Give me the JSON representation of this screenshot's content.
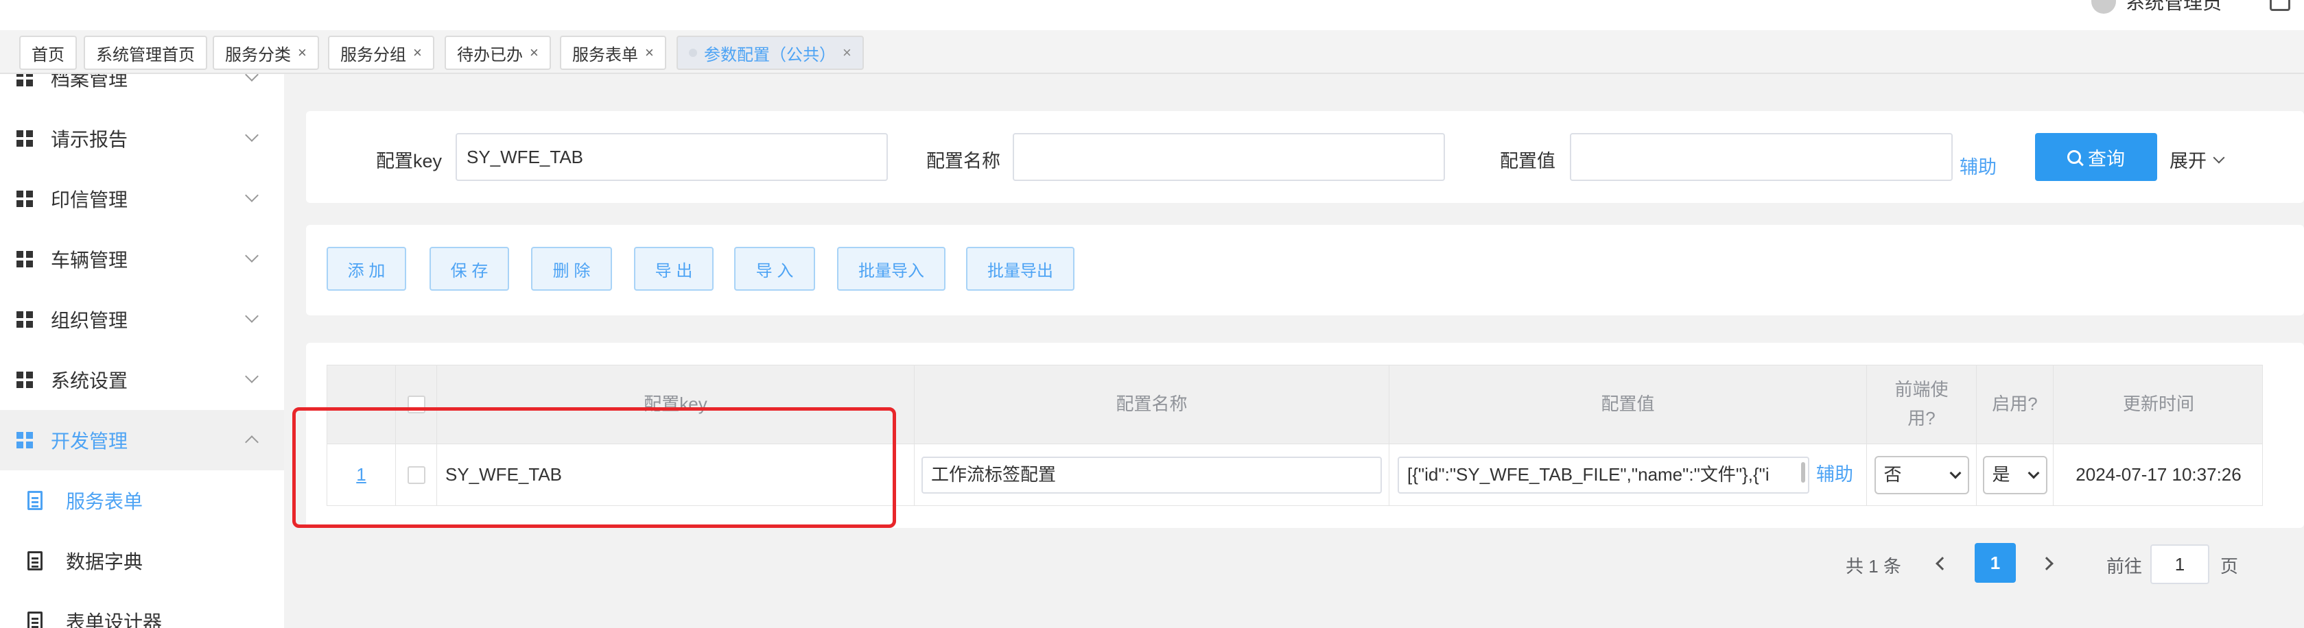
{
  "header": {
    "user_name": "系统管理员",
    "icons": [
      "user-avatar-icon",
      "logout-icon"
    ]
  },
  "tabs": [
    {
      "label": "首页",
      "closable": false
    },
    {
      "label": "系统管理首页",
      "closable": false
    },
    {
      "label": "服务分类",
      "closable": true
    },
    {
      "label": "服务分组",
      "closable": true
    },
    {
      "label": "待办已办",
      "closable": true
    },
    {
      "label": "服务表单",
      "closable": true
    },
    {
      "label": "参数配置（公共）",
      "closable": true,
      "active": true
    }
  ],
  "tab_close_glyph": "×",
  "sidebar": {
    "items": [
      {
        "label": "档案管理",
        "icon": "grid-icon"
      },
      {
        "label": "请示报告",
        "icon": "grid-icon"
      },
      {
        "label": "印信管理",
        "icon": "grid-icon"
      },
      {
        "label": "车辆管理",
        "icon": "grid-icon"
      },
      {
        "label": "组织管理",
        "icon": "grid-icon"
      },
      {
        "label": "系统设置",
        "icon": "grid-icon"
      },
      {
        "label": "开发管理",
        "icon": "grid-icon",
        "expanded": true
      }
    ],
    "sub_items": [
      {
        "label": "服务表单",
        "icon": "document-icon",
        "active": true
      },
      {
        "label": "数据字典",
        "icon": "document-icon"
      },
      {
        "label": "表单设计器",
        "icon": "document-icon"
      }
    ]
  },
  "search": {
    "key_label": "配置key",
    "key_value": "SY_WFE_TAB",
    "name_label": "配置名称",
    "name_value": "",
    "value_label": "配置值",
    "value_value": "",
    "helper_link": "辅助",
    "query_button": "查询",
    "expand_label": "展开"
  },
  "toolbar": {
    "buttons": [
      "添 加",
      "保 存",
      "删 除",
      "导 出",
      "导 入",
      "批量导入",
      "批量导出"
    ]
  },
  "table": {
    "columns": [
      "",
      "",
      "配置key",
      "配置名称",
      "配置值",
      "前端使用?",
      "启用?",
      "更新时间"
    ],
    "rows": [
      {
        "index": "1",
        "key": "SY_WFE_TAB",
        "name": "工作流标签配置",
        "value": "[{\"id\":\"SY_WFE_TAB_FILE\",\"name\":\"文件\"},{\"i",
        "value_helper": "辅助",
        "frontend": "否",
        "enabled": "是",
        "updated": "2024-07-17 10:37:26"
      }
    ]
  },
  "pagination": {
    "total": "共 1 条",
    "current_page": "1",
    "goto_label": "前往",
    "goto_value": "1",
    "page_suffix": "页"
  },
  "colors": {
    "accent": "#2d9af0",
    "highlight_border": "#e8262a",
    "link": "#4da3f4"
  }
}
